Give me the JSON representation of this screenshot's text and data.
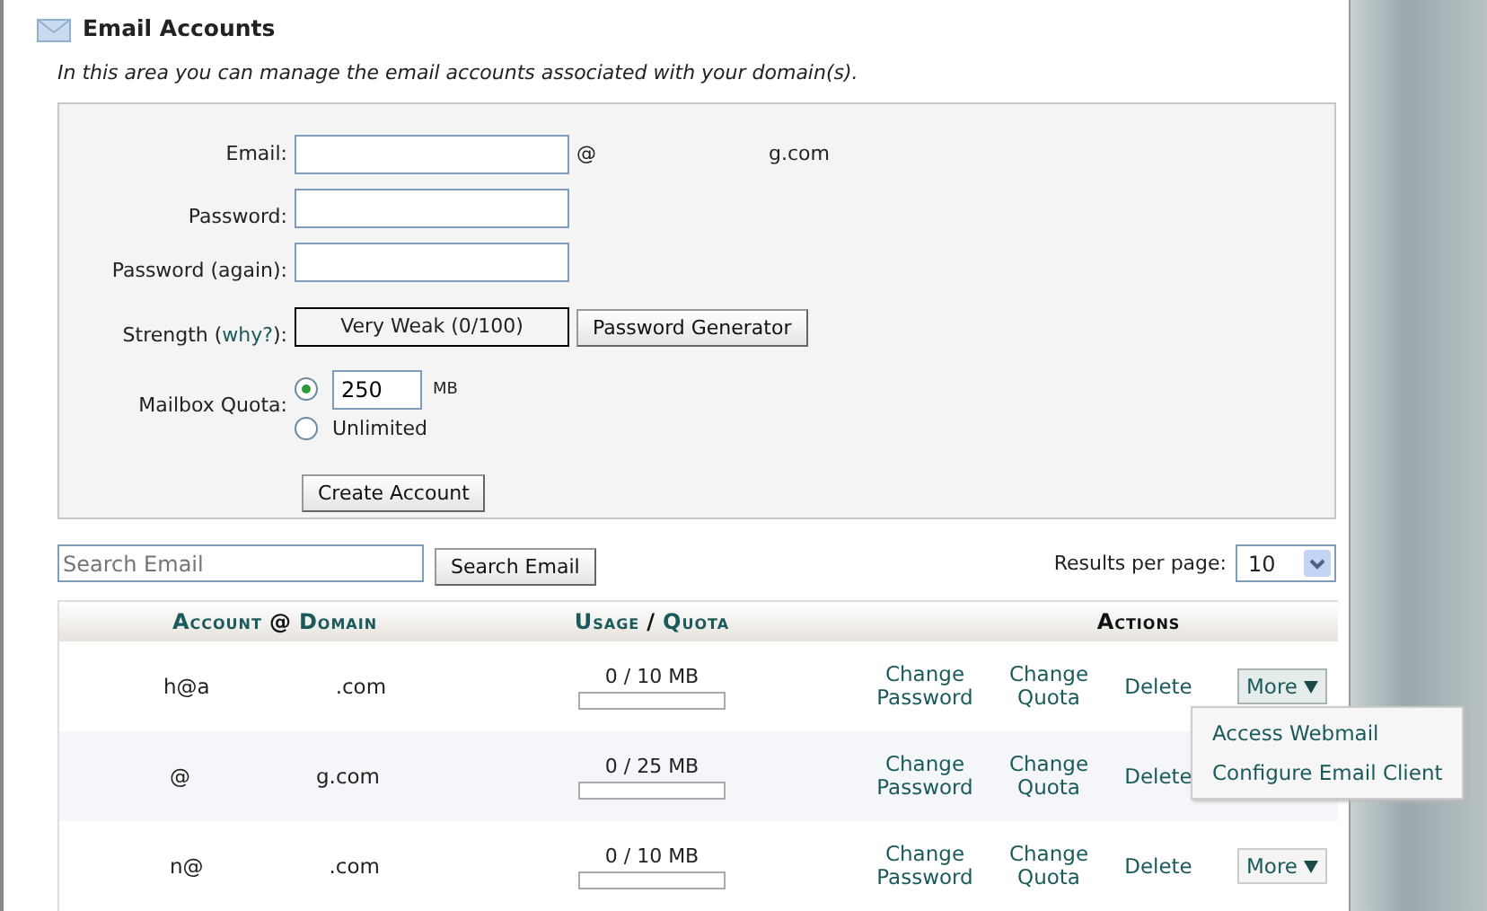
{
  "header": {
    "title": "Email Accounts",
    "description": "In this area you can manage the email accounts associated with your domain(s)."
  },
  "form": {
    "email_label": "Email:",
    "at": "@",
    "domain": "g.com",
    "password_label": "Password:",
    "password_again_label": "Password (again):",
    "strength_label": "Strength (",
    "why_link": "why?",
    "strength_close": "):",
    "strength_value": "Very Weak (0/100)",
    "generator_button": "Password Generator",
    "quota_label": "Mailbox Quota:",
    "quota_options": [
      {
        "kind": "amount",
        "selected": true,
        "value": "250",
        "unit": "MB"
      },
      {
        "kind": "unlimited",
        "selected": false,
        "label": "Unlimited"
      }
    ],
    "create_button": "Create Account"
  },
  "search": {
    "placeholder": "Search Email",
    "button": "Search Email",
    "results_label": "Results per page:",
    "results_value": "10"
  },
  "table": {
    "columns": [
      {
        "parts": [
          {
            "kind": "link",
            "text": "Account"
          },
          {
            "kind": "plain",
            "text": "@"
          },
          {
            "kind": "link",
            "text": "Domain"
          }
        ]
      },
      {
        "parts": [
          {
            "kind": "link",
            "text": "Usage"
          },
          {
            "kind": "plain",
            "text": "/"
          },
          {
            "kind": "link",
            "text": "Quota"
          }
        ]
      },
      {
        "parts": [
          {
            "kind": "plain",
            "text": "Actions"
          }
        ]
      }
    ],
    "rows": [
      {
        "account": [
          "h@a",
          ".com"
        ],
        "usage": "0 / 10 MB",
        "actions": [
          "Change Password",
          "Change Quota",
          "Delete"
        ],
        "more": "More",
        "expanded": true,
        "menu": [
          "Access Webmail",
          "Configure Email Client"
        ]
      },
      {
        "account": [
          "@",
          "g.com"
        ],
        "usage": "0 / 25 MB",
        "actions": [
          "Change Password",
          "Change Quota",
          "Delete"
        ]
      },
      {
        "account": [
          "n@",
          ".com"
        ],
        "usage": "0 / 10 MB",
        "actions": [
          "Change Password",
          "Change Quota",
          "Delete"
        ],
        "more": "More",
        "expanded": false
      }
    ]
  }
}
